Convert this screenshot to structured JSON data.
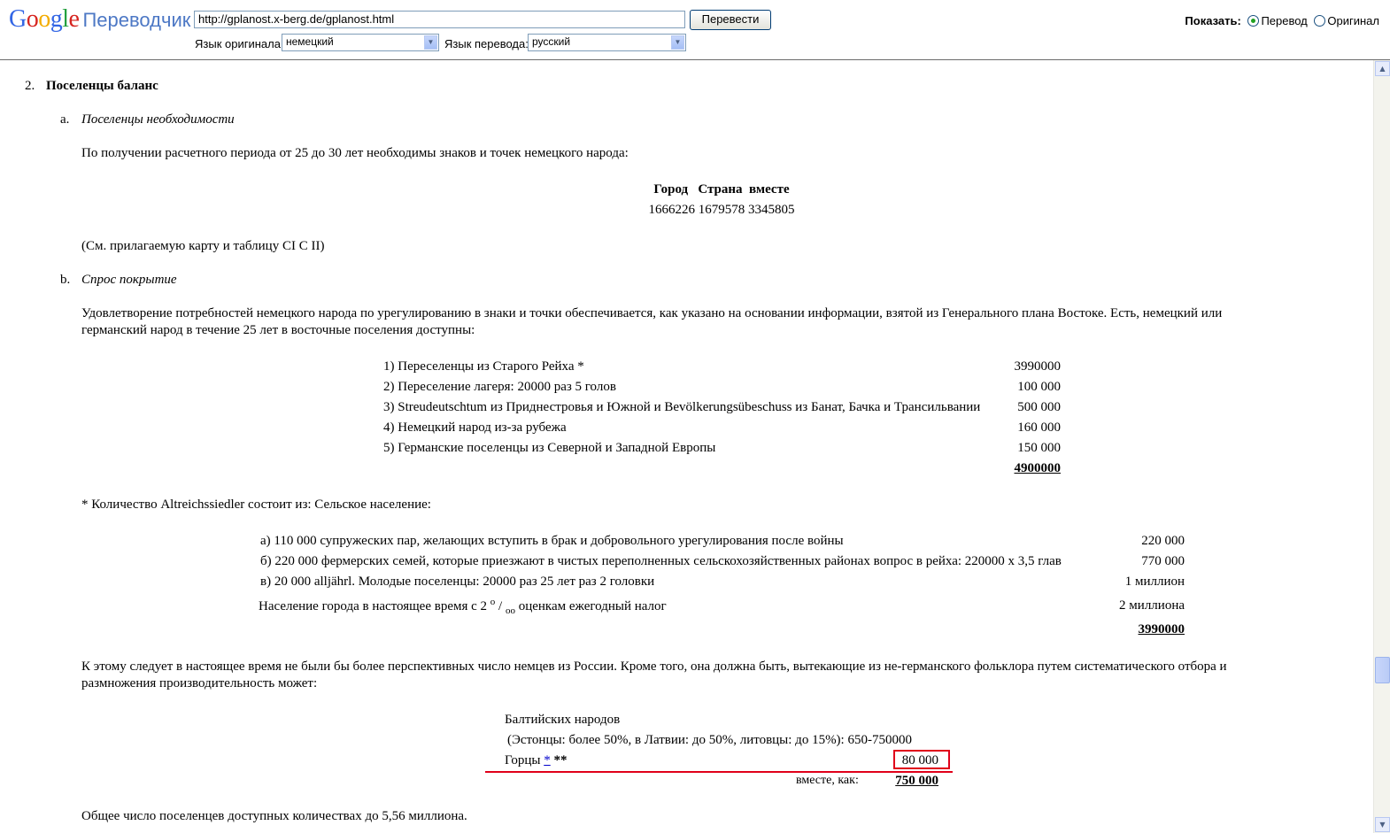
{
  "toolbar": {
    "logo_google": "Google",
    "logo_product": "Переводчик",
    "url_value": "http://gplanost.x-berg.de/gplanost.html",
    "submit_label": "Перевести",
    "source_lang_label": "Язык оригинала:",
    "source_lang_value": "немецкий",
    "target_lang_label": "Язык перевода:",
    "target_lang_value": "русский",
    "show_label": "Показать:",
    "show_translation": "Перевод",
    "show_original": "Оригинал"
  },
  "doc": {
    "section_num": "2.",
    "section_title": "Поселенцы баланс",
    "a_marker": "a.",
    "a_title": "Поселенцы необходимости",
    "a_para": "По получении расчетного периода от 25 до 30 лет необходимы знаков и точек немецкого народа:",
    "table1_header": "Город   Страна  вместе",
    "table1_values": "1666226 1679578 3345805",
    "see_map": "(См. прилагаемую карту и таблицу CI C II)",
    "b_marker": "b.",
    "b_title": "Спрос покрытие",
    "b_para_line1": "Удовлетворение потребностей немецкого народа по урегулированию в знаки и точки обеспечивается, как указано на основании информации, взятой из Генерального плана Востоке.  Есть, немецкий или",
    "b_para_line2": "германский народ в течение 25 лет в восточные поселения доступны:",
    "list1": [
      {
        "label": "1) Переселенцы из Старого Рейха *",
        "value": "3990000"
      },
      {
        "label": "2) Переселение лагеря: 20000 раз 5 голов",
        "value": "100 000"
      },
      {
        "label": "3) Streudeutschtum из Приднестровья и Южной и Bevölkerungsübeschuss из Банат, Бачка и Трансильвании",
        "value": "500 000"
      },
      {
        "label": "4) Немецкий народ из-за рубежа",
        "value": "160 000"
      },
      {
        "label": "5) Германские поселенцы из Северной и Западной Европы",
        "value": "150 000"
      }
    ],
    "list1_total": "4900000",
    "footnote": "* Количество Altreichssiedler состоит из: Сельское население:",
    "list2": [
      {
        "label": "а) 110 000 супружеских пар, желающих вступить в брак и добровольного урегулирования после войны",
        "value": "220 000"
      },
      {
        "label": "б) 220 000 фермерских семей, которые приезжают в чистых переполненных сельскохозяйственных районах вопрос в рейха: 220000 х 3,5 глав",
        "value": "770 000"
      },
      {
        "label": "в) 20 000 alljährl.  Молодые поселенцы: 20000 раз 25 лет раз 2 головки",
        "value": "1 миллион"
      }
    ],
    "list2_city_pre": "Население города в настоящее время с 2",
    "list2_city_sup": "о",
    "list2_city_slash": " / ",
    "list2_city_sub": "оо",
    "list2_city_post": " оценкам ежегодный налог",
    "list2_city_value": "2 миллиона",
    "list2_total": "3990000",
    "russia_para_line1": "К этому следует в настоящее время не были бы более перспективных число немцев из России.  Кроме того, она должна быть, вытекающие из не-германского фольклора путем систематического отбора и",
    "russia_para_line2": "размножения производительность может:",
    "baltic_title": "Балтийских народов",
    "baltic_detail": "(Эстонцы: более 50%, в Латвии: до 50%, литовцы: до 15%): 650-750000",
    "gortsy_label": "Горцы",
    "gortsy_link": "*",
    "gortsy_stars": "**",
    "gortsy_value": "80 000",
    "together_label": "вместе, как:",
    "together_value": "750 000",
    "final_line": "Общее число поселенцев доступных количествах до 5,56 миллиона."
  },
  "colors": {
    "highlight": "#e0001a",
    "link": "#0000cc",
    "brand_blue": "#4d78c5"
  },
  "icons": {
    "scroll_up": "scroll-up-arrow-icon",
    "scroll_down": "scroll-down-arrow-icon",
    "dropdown": "chevron-down-icon",
    "radio": "radio-button-icon"
  }
}
